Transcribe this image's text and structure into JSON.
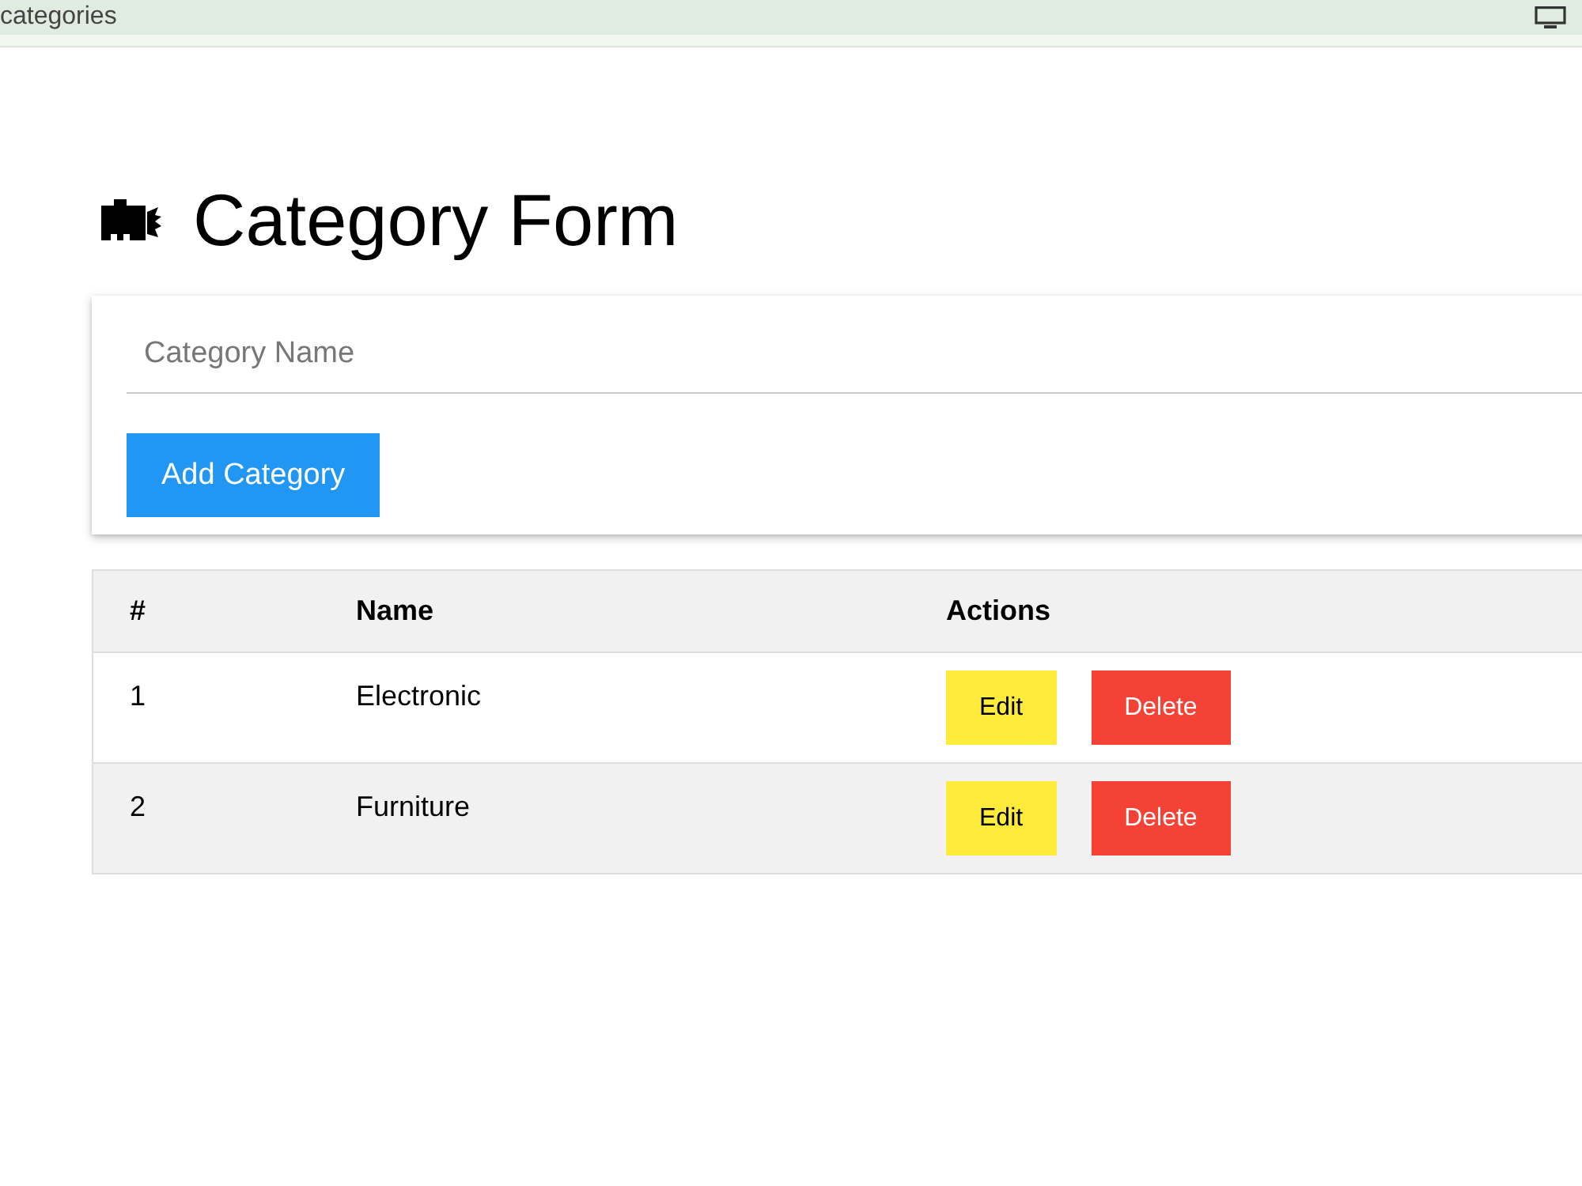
{
  "top_bar": {
    "title": "categories"
  },
  "heading": {
    "title": "Category Form"
  },
  "form": {
    "placeholder": "Category Name",
    "submit": "Add Category"
  },
  "table": {
    "columns": [
      "#",
      "Name",
      "Actions"
    ],
    "rows": [
      {
        "number": "1",
        "name": "Electronic",
        "actions": [
          {
            "kind": "edit",
            "label": "Edit"
          },
          {
            "kind": "delete",
            "label": "Delete"
          }
        ]
      },
      {
        "number": "2",
        "name": "Furniture",
        "actions": [
          {
            "kind": "edit",
            "label": "Edit"
          },
          {
            "kind": "delete",
            "label": "Delete"
          }
        ]
      }
    ]
  }
}
